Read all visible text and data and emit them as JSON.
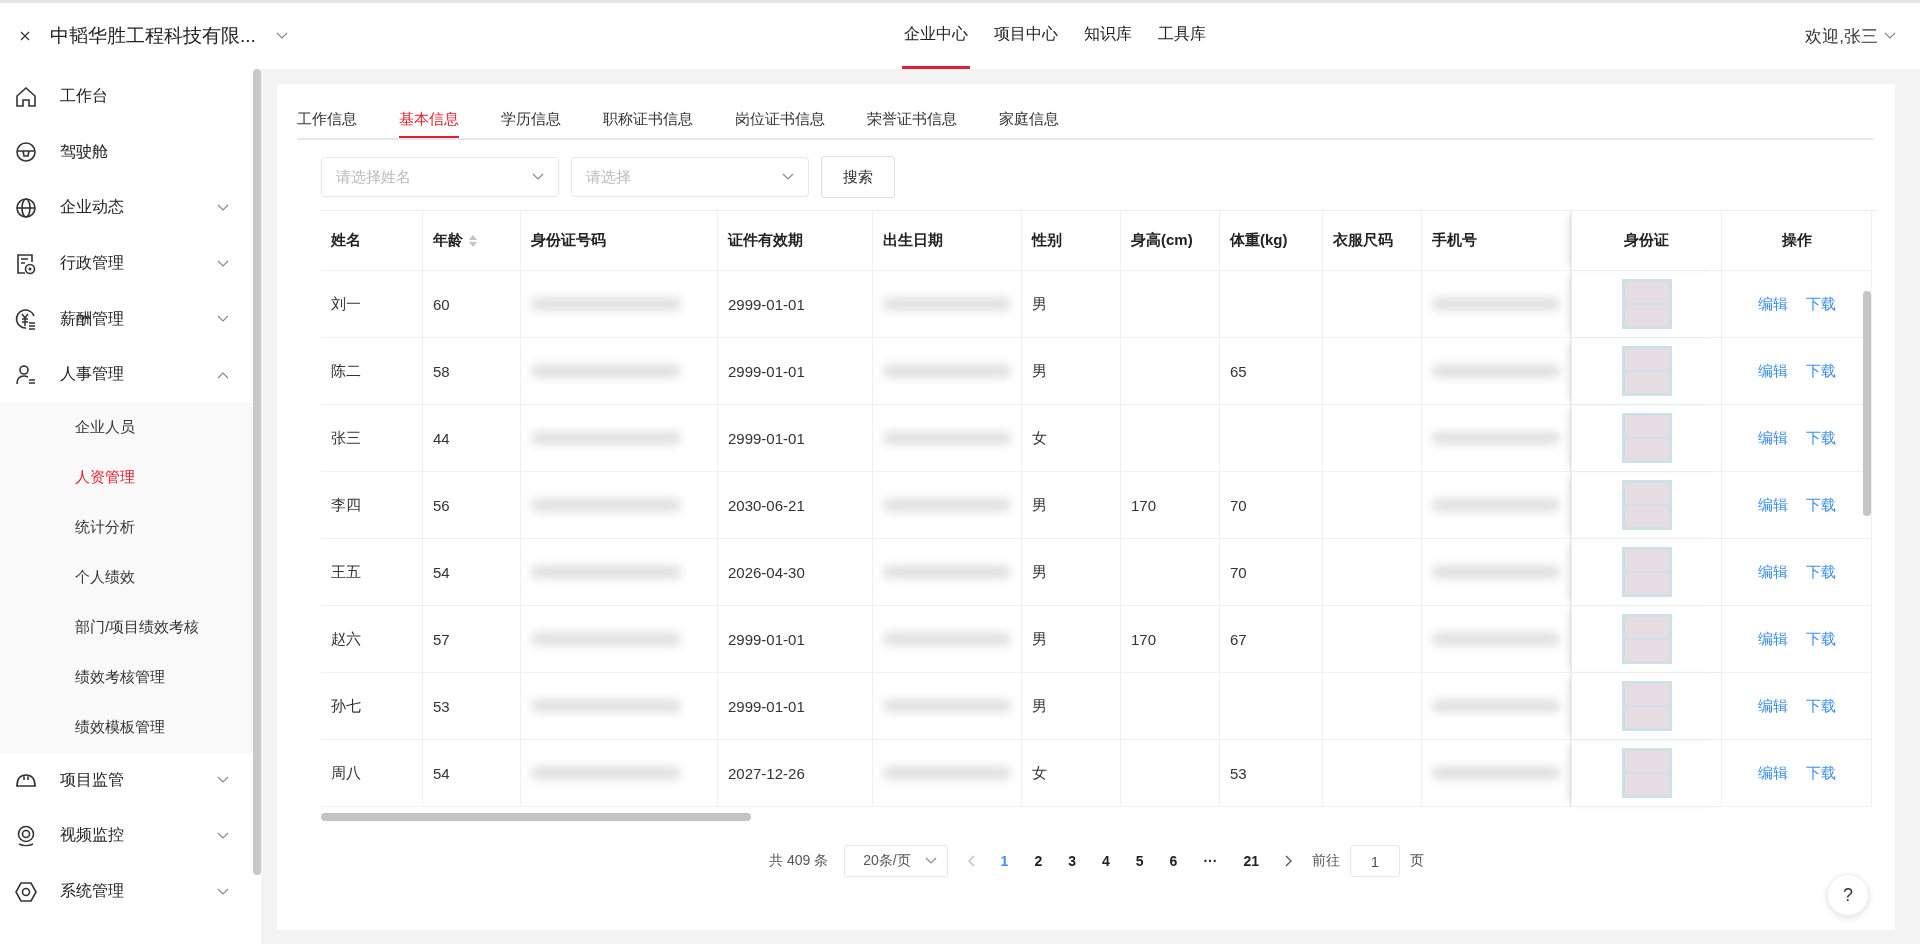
{
  "header": {
    "company": "中韬华胜工程科技有限...",
    "nav": [
      {
        "label": "企业中心",
        "selected": true
      },
      {
        "label": "项目中心",
        "selected": false
      },
      {
        "label": "知识库",
        "selected": false
      },
      {
        "label": "工具库",
        "selected": false
      }
    ],
    "user": "欢迎,张三"
  },
  "sidebar": {
    "items": [
      {
        "label": "工作台"
      },
      {
        "label": "驾驶舱"
      },
      {
        "label": "企业动态",
        "expanded": false
      },
      {
        "label": "行政管理",
        "expanded": false
      },
      {
        "label": "薪酬管理",
        "expanded": false
      },
      {
        "label": "人事管理",
        "expanded": true,
        "children": [
          {
            "label": "企业人员",
            "selected": false
          },
          {
            "label": "人资管理",
            "selected": true
          },
          {
            "label": "统计分析",
            "selected": false
          },
          {
            "label": "个人绩效",
            "selected": false
          },
          {
            "label": "部门/项目绩效考核",
            "selected": false
          },
          {
            "label": "绩效考核管理",
            "selected": false
          },
          {
            "label": "绩效模板管理",
            "selected": false
          }
        ]
      },
      {
        "label": "项目监管",
        "expanded": false
      },
      {
        "label": "视频监控",
        "expanded": false
      },
      {
        "label": "系统管理",
        "expanded": false
      }
    ]
  },
  "tabs": [
    {
      "label": "工作信息",
      "selected": false
    },
    {
      "label": "基本信息",
      "selected": true
    },
    {
      "label": "学历信息",
      "selected": false
    },
    {
      "label": "职称证书信息",
      "selected": false
    },
    {
      "label": "岗位证书信息",
      "selected": false
    },
    {
      "label": "荣誉证书信息",
      "selected": false
    },
    {
      "label": "家庭信息",
      "selected": false
    }
  ],
  "filters": [
    {
      "placeholder": "请选择姓名"
    },
    {
      "placeholder": "请选择"
    }
  ],
  "search_button": "搜索",
  "table": {
    "columns": [
      {
        "label": "姓名",
        "kind": "text",
        "sortable": false
      },
      {
        "label": "年龄",
        "kind": "text",
        "sortable": true
      },
      {
        "label": "身份证号码",
        "kind": "masked",
        "sortable": false
      },
      {
        "label": "证件有效期",
        "kind": "text",
        "sortable": false
      },
      {
        "label": "出生日期",
        "kind": "masked",
        "sortable": false
      },
      {
        "label": "性别",
        "kind": "text",
        "sortable": false
      },
      {
        "label": "身高(cm)",
        "kind": "text",
        "sortable": false
      },
      {
        "label": "体重(kg)",
        "kind": "text",
        "sortable": false
      },
      {
        "label": "衣服尺码",
        "kind": "text",
        "sortable": false
      },
      {
        "label": "手机号",
        "kind": "masked",
        "sortable": false
      },
      {
        "label": "身份证",
        "kind": "image",
        "sortable": false
      },
      {
        "label": "操作",
        "kind": "actions",
        "sortable": false
      }
    ],
    "rows": [
      {
        "cells": [
          "刘一",
          "60",
          null,
          "2999-01-01",
          null,
          "男",
          null,
          null,
          null,
          null
        ],
        "actions": [
          "编辑",
          "下载"
        ]
      },
      {
        "cells": [
          "陈二",
          "58",
          null,
          "2999-01-01",
          null,
          "男",
          null,
          "65",
          null,
          null
        ],
        "actions": [
          "编辑",
          "下载"
        ]
      },
      {
        "cells": [
          "张三",
          "44",
          null,
          "2999-01-01",
          null,
          "女",
          null,
          null,
          null,
          null
        ],
        "actions": [
          "编辑",
          "下载"
        ]
      },
      {
        "cells": [
          "李四",
          "56",
          null,
          "2030-06-21",
          null,
          "男",
          "170",
          "70",
          null,
          null
        ],
        "actions": [
          "编辑",
          "下载"
        ]
      },
      {
        "cells": [
          "王五",
          "54",
          null,
          "2026-04-30",
          null,
          "男",
          null,
          "70",
          null,
          null
        ],
        "actions": [
          "编辑",
          "下载"
        ]
      },
      {
        "cells": [
          "赵六",
          "57",
          null,
          "2999-01-01",
          null,
          "男",
          "170",
          "67",
          null,
          null
        ],
        "actions": [
          "编辑",
          "下载"
        ]
      },
      {
        "cells": [
          "孙七",
          "53",
          null,
          "2999-01-01",
          null,
          "男",
          null,
          null,
          null,
          null
        ],
        "actions": [
          "编辑",
          "下载"
        ]
      },
      {
        "cells": [
          "周八",
          "54",
          null,
          "2027-12-26",
          null,
          "女",
          null,
          "53",
          null,
          null
        ],
        "actions": [
          "编辑",
          "下载"
        ]
      }
    ]
  },
  "pagination": {
    "total": "共 409 条",
    "page_size": "20条/页",
    "pages": [
      {
        "label": "1",
        "selected": true
      },
      {
        "label": "2",
        "selected": false
      },
      {
        "label": "3",
        "selected": false
      },
      {
        "label": "4",
        "selected": false
      },
      {
        "label": "5",
        "selected": false
      },
      {
        "label": "6",
        "selected": false
      },
      {
        "label": "···",
        "selected": false
      },
      {
        "label": "21",
        "selected": false
      }
    ],
    "goto_label": "前往",
    "goto_value": "1",
    "page_unit": "页"
  },
  "help": "?"
}
